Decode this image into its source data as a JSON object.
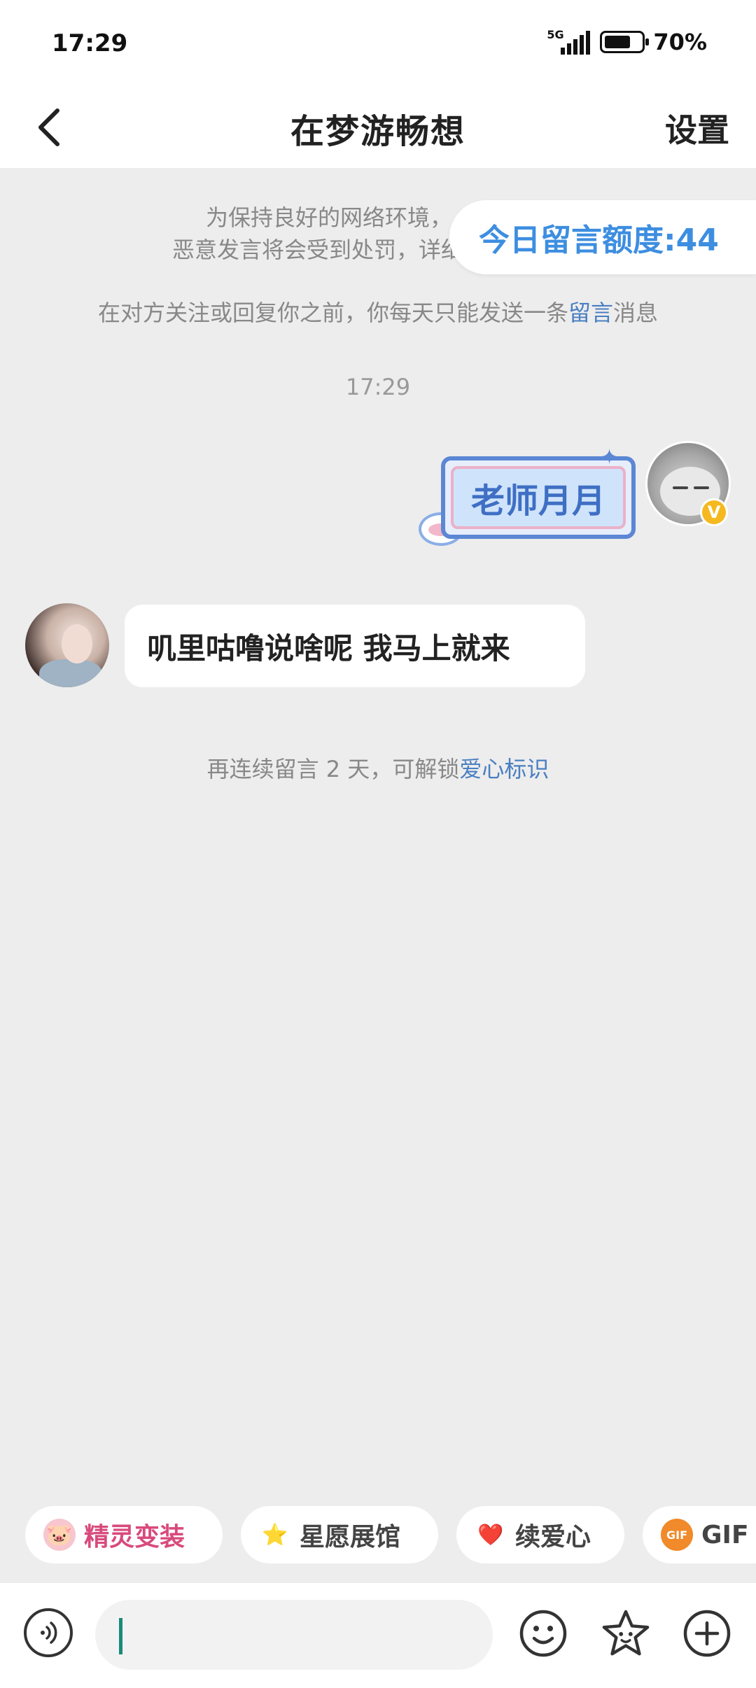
{
  "status_bar": {
    "time": "17:29",
    "network": "5G",
    "battery": "70%",
    "battery_level": 0.7
  },
  "header": {
    "title": "在梦游畅想",
    "settings_label": "设置",
    "back_icon": "back-arrow-icon"
  },
  "notices": {
    "line1": "为保持良好的网络环境，",
    "line2": "恶意发言将会受到处罚，详细细",
    "quota": "今日留言额度:44",
    "limit_before": "在对方关注或回复你之前，你每天只能发送一条",
    "limit_highlight": "留言",
    "limit_after": "消息"
  },
  "timestamp": "17:29",
  "messages": [
    {
      "sender": "me",
      "text": "老师月月"
    },
    {
      "sender": "other",
      "text": "叽里咕噜说啥呢 我马上就来"
    }
  ],
  "vip_badge": "V",
  "unlock_notice": {
    "before": "再连续留言 2 天，可解锁",
    "highlight": "爱心标识"
  },
  "quick_actions": [
    {
      "label": "精灵变装",
      "icon": "pig-icon"
    },
    {
      "label": "星愿展馆",
      "icon": "star-icon"
    },
    {
      "label": "续爱心",
      "icon": "heart-icon"
    },
    {
      "label": "GIF",
      "icon": "gif-icon"
    }
  ],
  "gif_icon_text": "GIF",
  "composer": {
    "input_value": "",
    "voice_icon": "voice-icon",
    "emoji_icon": "emoji-icon",
    "sticker_icon": "sticker-icon",
    "plus_icon": "plus-icon"
  },
  "colors": {
    "accent_blue": "#3d8ee0",
    "highlight_blue": "#4a7fc2",
    "chip_pink": "#d84a7c",
    "caret_green": "#1a8a7a"
  }
}
